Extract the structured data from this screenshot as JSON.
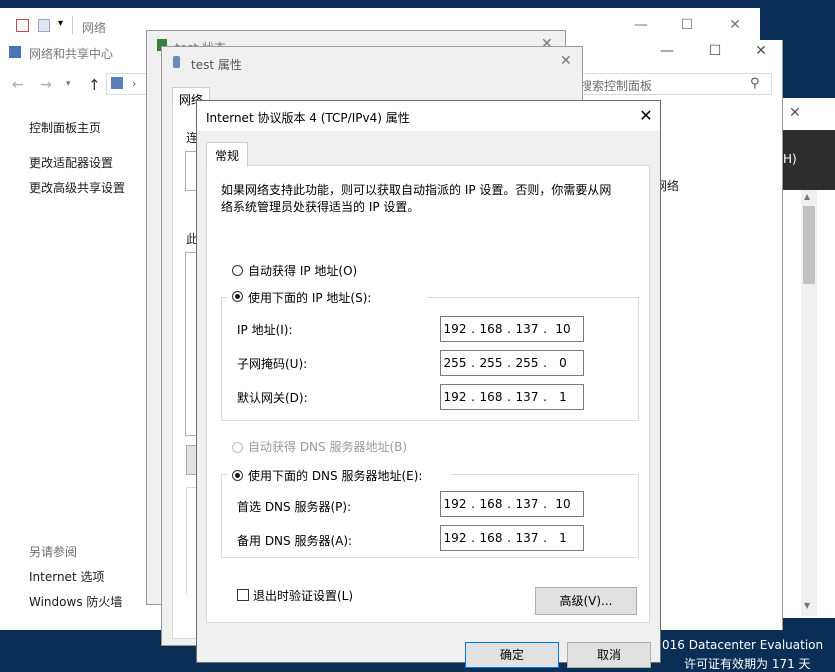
{
  "network_window": {
    "title": "网络",
    "minimize": "—",
    "maximize": "☐",
    "close": "✕"
  },
  "control_panel": {
    "breadcrumb_title": "网络和共享中心",
    "nav_back": "←",
    "nav_forward": "→",
    "nav_up": "↑",
    "search_placeholder": "搜索控制面板",
    "sidebar": {
      "items": [
        {
          "label": "控制面板主页"
        },
        {
          "label": "更改适配器设置"
        },
        {
          "label": "更改高级共享设置"
        }
      ],
      "see_also_header": "另请参阅",
      "see_also": [
        {
          "label": "Internet 选项"
        },
        {
          "label": "Windows 防火墙"
        }
      ]
    },
    "right_fragment_network": "网络",
    "minimize": "—",
    "maximize": "☐",
    "close": "✕"
  },
  "status_window": {
    "title": "test 状态",
    "close": "✕"
  },
  "properties_window": {
    "title": "test 属性",
    "tab_label": "网络",
    "fragment_connect": "连",
    "fragment_this": "此",
    "close": "✕"
  },
  "desktop": {
    "watermark_line1": "016 Datacenter Evaluation",
    "watermark_line2": "许可证有效期为 171 天",
    "right_window_fragment": "H)"
  },
  "ipv4_dialog": {
    "title": "Internet 协议版本 4 (TCP/IPv4) 属性",
    "close": "✕",
    "tab_general": "常规",
    "description": "如果网络支持此功能，则可以获取自动指派的 IP 设置。否则，你需要从网络系统管理员处获得适当的 IP 设置。",
    "ip_auto": {
      "label": "自动获得 IP 地址(O)",
      "selected": false
    },
    "ip_manual": {
      "label": "使用下面的 IP 地址(S):",
      "selected": true
    },
    "ip_address": {
      "label": "IP 地址(I):",
      "octets": [
        "192",
        "168",
        "137",
        "10"
      ]
    },
    "subnet_mask": {
      "label": "子网掩码(U):",
      "octets": [
        "255",
        "255",
        "255",
        "0"
      ]
    },
    "default_gateway": {
      "label": "默认网关(D):",
      "octets": [
        "192",
        "168",
        "137",
        "1"
      ]
    },
    "dns_auto": {
      "label": "自动获得 DNS 服务器地址(B)",
      "selected": false,
      "disabled": true
    },
    "dns_manual": {
      "label": "使用下面的 DNS 服务器地址(E):",
      "selected": true
    },
    "preferred_dns": {
      "label": "首选 DNS 服务器(P):",
      "octets": [
        "192",
        "168",
        "137",
        "10"
      ]
    },
    "alternate_dns": {
      "label": "备用 DNS 服务器(A):",
      "octets": [
        "192",
        "168",
        "137",
        "1"
      ]
    },
    "validate_on_exit": {
      "label": "退出时验证设置(L)",
      "checked": false
    },
    "advanced_button": "高级(V)...",
    "ok_button": "确定",
    "cancel_button": "取消"
  }
}
